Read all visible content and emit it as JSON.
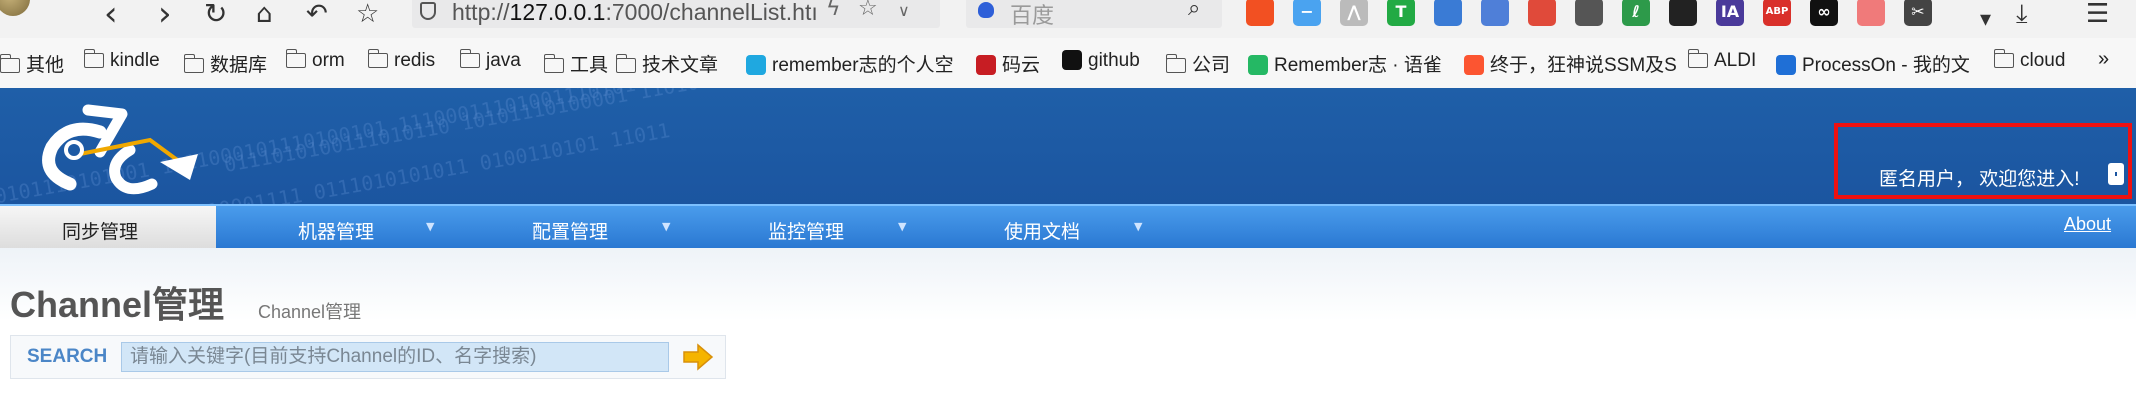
{
  "browser": {
    "url_prefix": "http://",
    "url_host": "127.0.0.1",
    "url_rest": ":7000/channelList.htı",
    "search_placeholder": "百度",
    "extensions": [
      {
        "name": "ms-grid-icon",
        "text": "",
        "color": "#f25022"
      },
      {
        "name": "minus-circle-icon",
        "text": "−",
        "color": "#4aa3f0"
      },
      {
        "name": "a-logo-icon",
        "text": "⋀",
        "color": "#bbbbbb"
      },
      {
        "name": "t-green-icon",
        "text": "T",
        "color": "#22aa44"
      },
      {
        "name": "globe-icon",
        "text": "",
        "color": "#3a7bd5"
      },
      {
        "name": "diamond-icon",
        "text": "",
        "color": "#4f7fd8"
      },
      {
        "name": "cube-icon",
        "text": "",
        "color": "#e04a3a"
      },
      {
        "name": "apps-icon",
        "text": "",
        "color": "#555555"
      },
      {
        "name": "leaf-icon",
        "text": "ℓ",
        "color": "#2d9a4a"
      },
      {
        "name": "ghost-icon",
        "text": "",
        "color": "#222222"
      },
      {
        "name": "ia-icon",
        "text": "IA",
        "color": "#4a3a9a"
      },
      {
        "name": "abp-icon",
        "text": "ABP",
        "color": "#d9302a"
      },
      {
        "name": "infinity-icon",
        "text": "∞",
        "color": "#111111"
      },
      {
        "name": "ring-icon",
        "text": "",
        "color": "#f07a7a"
      },
      {
        "name": "scissors-icon",
        "text": "✂",
        "color": "#444444"
      }
    ]
  },
  "bookmarks": [
    {
      "label": "其他",
      "icon": "folder"
    },
    {
      "label": "kindle",
      "icon": "folder"
    },
    {
      "label": "数据库",
      "icon": "folder"
    },
    {
      "label": "orm",
      "icon": "folder"
    },
    {
      "label": "redis",
      "icon": "folder"
    },
    {
      "label": "java",
      "icon": "folder"
    },
    {
      "label": "工具",
      "icon": "folder"
    },
    {
      "label": "技术文章",
      "icon": "folder"
    },
    {
      "label": "remember志的个人空",
      "icon": "bilibili",
      "color": "#1fa8e0"
    },
    {
      "label": "码云",
      "icon": "gitee",
      "color": "#c71d23"
    },
    {
      "label": "github",
      "icon": "github",
      "color": "#111111"
    },
    {
      "label": "公司",
      "icon": "folder"
    },
    {
      "label": "Remember志 · 语雀",
      "icon": "yuque",
      "color": "#25b864"
    },
    {
      "label": "终于，狂神说SSM及S",
      "icon": "csdn",
      "color": "#fc5531"
    },
    {
      "label": "ALDI",
      "icon": "folder"
    },
    {
      "label": "ProcessOn - 我的文",
      "icon": "processon",
      "color": "#1f6fd6"
    },
    {
      "label": "cloud",
      "icon": "folder"
    }
  ],
  "header": {
    "welcome": "匿名用户， 欢迎您进入!"
  },
  "menu": {
    "items": [
      {
        "label": "同步管理",
        "active": true,
        "dropdown": false
      },
      {
        "label": "机器管理",
        "active": false,
        "dropdown": true
      },
      {
        "label": "配置管理",
        "active": false,
        "dropdown": true
      },
      {
        "label": "监控管理",
        "active": false,
        "dropdown": true
      },
      {
        "label": "使用文档",
        "active": false,
        "dropdown": true
      }
    ],
    "about": "About"
  },
  "page": {
    "title": "Channel管理",
    "subtitle": "Channel管理",
    "search_label": "SEARCH",
    "search_placeholder": "请输入关键字(目前支持Channel的ID、名字搜索)"
  }
}
